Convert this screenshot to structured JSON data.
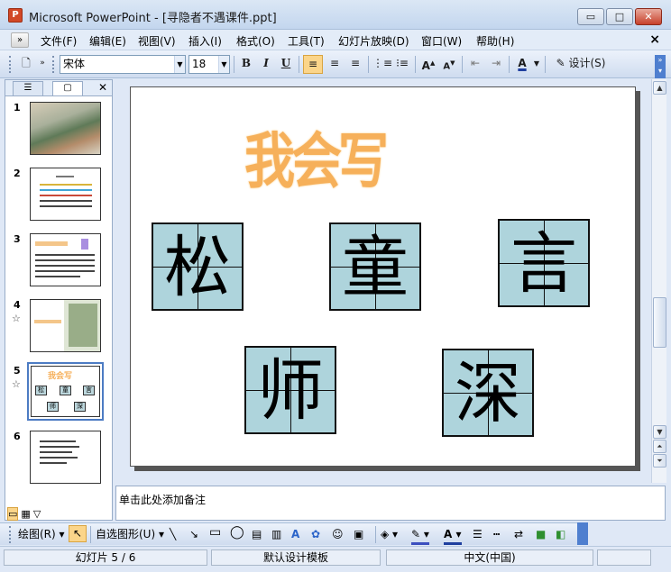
{
  "window": {
    "app_icon_letter": "P",
    "title": "Microsoft PowerPoint - [寻隐者不遇课件.ppt]",
    "min": "▭",
    "max": "□",
    "close": "✕"
  },
  "menu": {
    "items": [
      "文件(F)",
      "编辑(E)",
      "视图(V)",
      "插入(I)",
      "格式(O)",
      "工具(T)",
      "幻灯片放映(D)",
      "窗口(W)",
      "帮助(H)"
    ],
    "doc_close": "×"
  },
  "toolbar": {
    "font_name": "宋体",
    "font_size": "18",
    "bold": "B",
    "italic": "I",
    "underline": "U",
    "design_label": "设计(S)"
  },
  "panel": {
    "tab_outline": "☰",
    "tab_slides": "▢",
    "close": "✕",
    "slides": [
      {
        "num": "1",
        "star": ""
      },
      {
        "num": "2",
        "star": ""
      },
      {
        "num": "3",
        "star": ""
      },
      {
        "num": "4",
        "star": "☆"
      },
      {
        "num": "5",
        "star": "☆"
      },
      {
        "num": "6",
        "star": ""
      }
    ],
    "thumb5_title": "我会写",
    "thumb5_chars": [
      "松",
      "童",
      "言",
      "师",
      "深"
    ]
  },
  "slide": {
    "title": "我会写",
    "chars": [
      "松",
      "童",
      "言",
      "师",
      "深"
    ]
  },
  "notes": {
    "placeholder": "单击此处添加备注"
  },
  "drawbar": {
    "draw_label": "绘图(R)",
    "autoshape_label": "自选图形(U)"
  },
  "status": {
    "slide_pos": "幻灯片 5 / 6",
    "template": "默认设计模板",
    "language": "中文(中国)"
  },
  "colors": {
    "cell_fill": "#aed4dc",
    "title_color": "#f6b05a",
    "accent": "#4c7bc3"
  }
}
